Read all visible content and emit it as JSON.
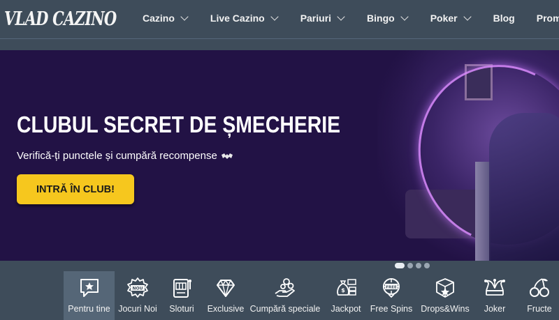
{
  "brand": {
    "logo_text": "VLAD CAZINO"
  },
  "nav": {
    "items": [
      {
        "label": "Cazino",
        "dropdown": true
      },
      {
        "label": "Live Cazino",
        "dropdown": true
      },
      {
        "label": "Pariuri",
        "dropdown": true
      },
      {
        "label": "Bingo",
        "dropdown": true
      },
      {
        "label": "Poker",
        "dropdown": true
      },
      {
        "label": "Blog",
        "dropdown": false
      },
      {
        "label": "Promoții",
        "dropdown": false
      }
    ]
  },
  "hero": {
    "title": "CLUBUL SECRET DE ȘMECHERIE",
    "subtitle": "Verifică-ți punctele și cumpără recompense",
    "subtitle_icon": "bat-icon",
    "cta_label": "INTRĂ ÎN CLUB!",
    "carousel_slides": 4,
    "carousel_active_index": 0
  },
  "categories": {
    "active": "Pentru tine",
    "items": [
      {
        "label": "Pentru tine",
        "icon": "star-chat-icon"
      },
      {
        "label": "Jocuri Noi",
        "icon": "new-badge-icon",
        "badge_text": "NOU"
      },
      {
        "label": "Sloturi",
        "icon": "slot-machine-icon"
      },
      {
        "label": "Exclusive",
        "icon": "diamond-icon"
      },
      {
        "label": "Cumpără speciale",
        "icon": "coins-hand-icon"
      },
      {
        "label": "Jackpot",
        "icon": "money-bag-icon"
      },
      {
        "label": "Free Spins",
        "icon": "free-spins-icon",
        "badge_text": "FREE"
      },
      {
        "label": "Drops&Wins",
        "icon": "gift-box-icon"
      },
      {
        "label": "Joker",
        "icon": "jester-hat-icon"
      },
      {
        "label": "Fructe",
        "icon": "cherries-icon"
      }
    ]
  },
  "colors": {
    "background": "#3e4c5a",
    "hero_bg": "#221245",
    "cta": "#f6c71e",
    "active_tab": "#556677"
  }
}
